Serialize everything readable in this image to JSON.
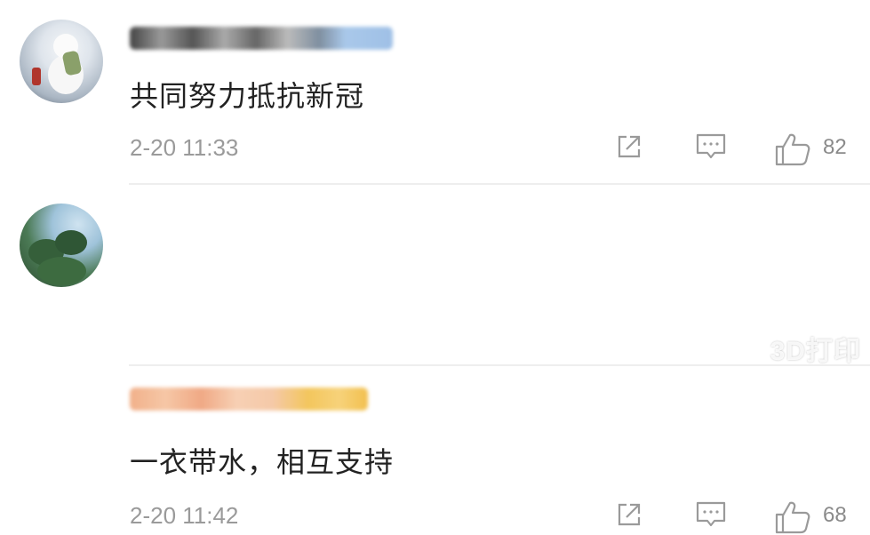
{
  "comments": [
    {
      "content": "共同努力抵抗新冠",
      "time": "2-20 11:33",
      "likes": "82",
      "avatar_icon": "snowman-avatar",
      "username_color": "#a9c8ea"
    },
    {
      "content": "一衣带水，相互支持",
      "time": "2-20 11:42",
      "likes": "68",
      "avatar_icon": "tree-avatar",
      "username_color": "#f3c65d"
    }
  ],
  "icons": {
    "share": "share-icon",
    "reply": "comment-icon",
    "like": "thumbs-up-icon"
  },
  "watermark": "3D打印"
}
